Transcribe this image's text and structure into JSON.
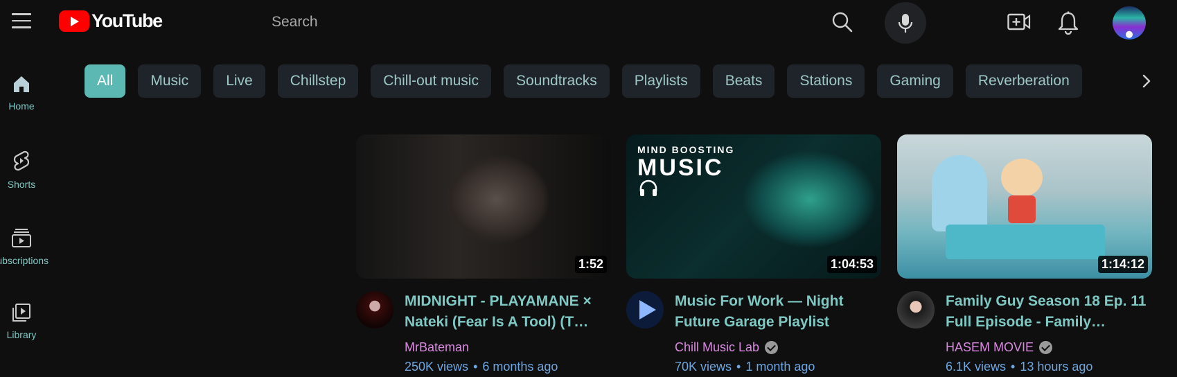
{
  "header": {
    "menu_icon": "hamburger-menu-icon",
    "logo_text": "YouTube",
    "search_placeholder": "Search",
    "search_icon": "search-icon",
    "mic_icon": "microphone-icon",
    "create_icon": "video-camera-plus-icon",
    "notifications_icon": "bell-icon",
    "brand_color": "#ff0000"
  },
  "sidebar": {
    "items": [
      {
        "label": "Home",
        "icon": "home-icon"
      },
      {
        "label": "Shorts",
        "icon": "shorts-icon"
      },
      {
        "label": "Subscriptions",
        "icon": "subscriptions-icon"
      },
      {
        "label": "Library",
        "icon": "library-icon"
      }
    ]
  },
  "chips": {
    "items": [
      "All",
      "Music",
      "Live",
      "Chillstep",
      "Chill-out music",
      "Soundtracks",
      "Playlists",
      "Beats",
      "Stations",
      "Gaming",
      "Reverberation"
    ],
    "active": "All",
    "next_icon": "chevron-right-icon",
    "accent_color": "#5cb8b2"
  },
  "videos": [
    {
      "title": "MIDNIGHT - PLAYAMANE × Nateki (Fear Is A Tool) (T…",
      "channel": "MrBateman",
      "verified": false,
      "views": "250K views",
      "age": "6 months ago",
      "duration": "1:52"
    },
    {
      "title": "Music For Work — Night Future Garage Playlist",
      "channel": "Chill Music Lab",
      "verified": true,
      "views": "70K views",
      "age": "1 month ago",
      "duration": "1:04:53",
      "thumb_text_small": "MIND BOOSTING",
      "thumb_text_big": "MUSIC"
    },
    {
      "title": "Family Guy Season 18 Ep. 11 Full Episode - Family…",
      "channel": "HASEM MOVIE",
      "verified": true,
      "views": "6.1K views",
      "age": "13 hours ago",
      "duration": "1:14:12"
    }
  ],
  "colors": {
    "background": "#0f0f0f",
    "title_text": "#7ec9c4",
    "channel_text": "#d98ae0",
    "meta_text": "#6fa6e0"
  }
}
